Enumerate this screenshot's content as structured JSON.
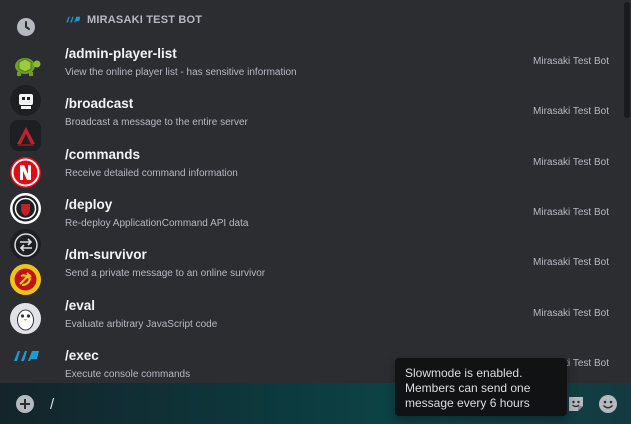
{
  "popup": {
    "header": "MIRASAKI TEST BOT",
    "commands": [
      {
        "name": "/admin-player-list",
        "description": "View the online player list - has sensitive information",
        "source": "Mirasaki Test Bot"
      },
      {
        "name": "/broadcast",
        "description": "Broadcast a message to the entire server",
        "source": "Mirasaki Test Bot"
      },
      {
        "name": "/commands",
        "description": "Receive detailed command information",
        "source": "Mirasaki Test Bot"
      },
      {
        "name": "/deploy",
        "description": "Re-deploy ApplicationCommand API data",
        "source": "Mirasaki Test Bot"
      },
      {
        "name": "/dm-survivor",
        "description": "Send a private message to an online survivor",
        "source": "Mirasaki Test Bot"
      },
      {
        "name": "/eval",
        "description": "Evaluate arbitrary JavaScript code",
        "source": "Mirasaki Test Bot"
      },
      {
        "name": "/exec",
        "description": "Execute console commands",
        "source": "Mirasaki Test Bot"
      }
    ]
  },
  "rail": {
    "icons": [
      "clock-icon",
      "turtle-icon",
      "robot-icon",
      "red-a-icon",
      "netflix-n-icon",
      "shield-icon",
      "swap-arrows-icon",
      "hammer-sickle-icon",
      "penguin-icon",
      "mirasaki-logo-icon"
    ]
  },
  "composer": {
    "value": "/"
  },
  "tooltip": {
    "text": "Slowmode is enabled. Members can send one message every 6 hours"
  },
  "colors": {
    "background": "#2b2d31",
    "selected_row": "#35373c",
    "accent": "#00a8fc",
    "tooltip_bg": "#111214"
  }
}
